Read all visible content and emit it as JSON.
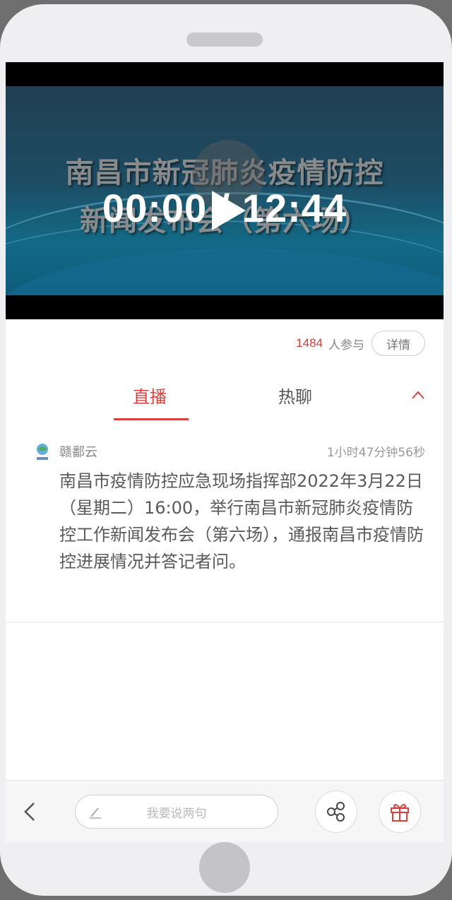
{
  "video": {
    "overlay_title_line1": "南昌市新冠肺炎疫情防控",
    "overlay_title_line2": "新闻发布会（第六场）",
    "time_display": "00:00 / 12:44"
  },
  "participants": {
    "count": "1484",
    "suffix": "人参与",
    "details_label": "详情"
  },
  "tabs": [
    {
      "label": "直播",
      "active": true
    },
    {
      "label": "热聊",
      "active": false
    }
  ],
  "post": {
    "author": "赣鄱云",
    "elapsed": "1小时47分钟56秒",
    "body": "南昌市疫情防控应急现场指挥部2022年3月22日（星期二）16:00，举行南昌市新冠肺炎疫情防控工作新闻发布会（第六场），通报南昌市疫情防控进展情况并答记者问。"
  },
  "bottom_bar": {
    "comment_placeholder": "我要说两句"
  },
  "colors": {
    "accent": "#d9423c",
    "video_bg": "#1d4c63"
  },
  "icons": [
    "play-icon",
    "chevron-up-icon",
    "app-logo-icon",
    "back-icon",
    "pencil-icon",
    "share-icon",
    "gift-icon"
  ]
}
